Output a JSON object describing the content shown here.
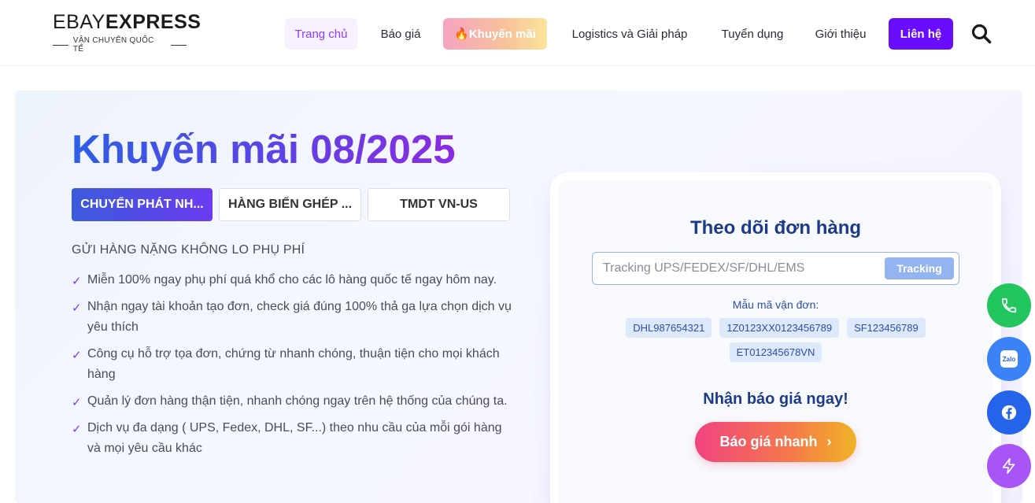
{
  "logo": {
    "brand_thin": "EBAY",
    "brand_bold": "EXPRESS",
    "tagline": "VẬN CHUYỂN QUỐC TẾ"
  },
  "nav": {
    "home": "Trang chủ",
    "quote": "Báo giá",
    "promo": "🔥Khuyến mãi",
    "logistics": "Logistics và Giải pháp",
    "jobs": "Tuyển dụng",
    "about": "Giới thiệu",
    "contact": "Liên hệ"
  },
  "hero": {
    "title": "Khuyến mãi 08/2025",
    "tabs": [
      "CHUYỂN PHÁT NH...",
      "HÀNG BIỂN GHÉP ...",
      "TMDT VN-US"
    ],
    "subheading": "GỬI HÀNG NẶNG KHÔNG LO PHỤ PHÍ",
    "check_mark": "✓",
    "features": [
      "Miễn 100% ngay phụ phí quá khổ cho các lô hàng quốc tế ngay hôm nay.",
      "Nhận ngay tài khoản tạo đơn, check giá đúng 100% thả ga lựa chọn dịch vụ yêu thích",
      "Công cụ hỗ trợ tọa đơn, chứng từ nhanh chóng, thuận tiện cho mọi khách hàng",
      "Quản lý đơn hàng thận tiện, nhanh chóng ngay trên hệ thống của chúng ta.",
      "Dịch vụ đa dạng ( UPS, Fedex, DHL, SF...) theo nhu cầu của mỗi gói hàng và mọi yêu cầu khác"
    ]
  },
  "tracking": {
    "title": "Theo dõi đơn hàng",
    "placeholder": "Tracking UPS/FEDEX/SF/DHL/EMS",
    "button": "Tracking",
    "sample_label": "Mẫu mã vận đơn:",
    "samples": [
      "DHL987654321",
      "1Z0123XX0123456789",
      "SF123456789",
      "ET012345678VN"
    ],
    "quote_heading": "Nhận báo giá ngay!",
    "quote_button": "Báo giá nhanh",
    "quote_arrow": "›"
  },
  "floating": {
    "zalo_label": "Zalo"
  },
  "icons": [
    "search-icon",
    "phone-icon",
    "zalo-icon",
    "facebook-icon",
    "bolt-icon",
    "check-icon",
    "chevron-right-icon"
  ],
  "colors": {
    "accent": "#6a0dff",
    "title_start": "#2d5ee6",
    "title_end": "#8a2be2",
    "card_title": "#1e3a8a"
  }
}
